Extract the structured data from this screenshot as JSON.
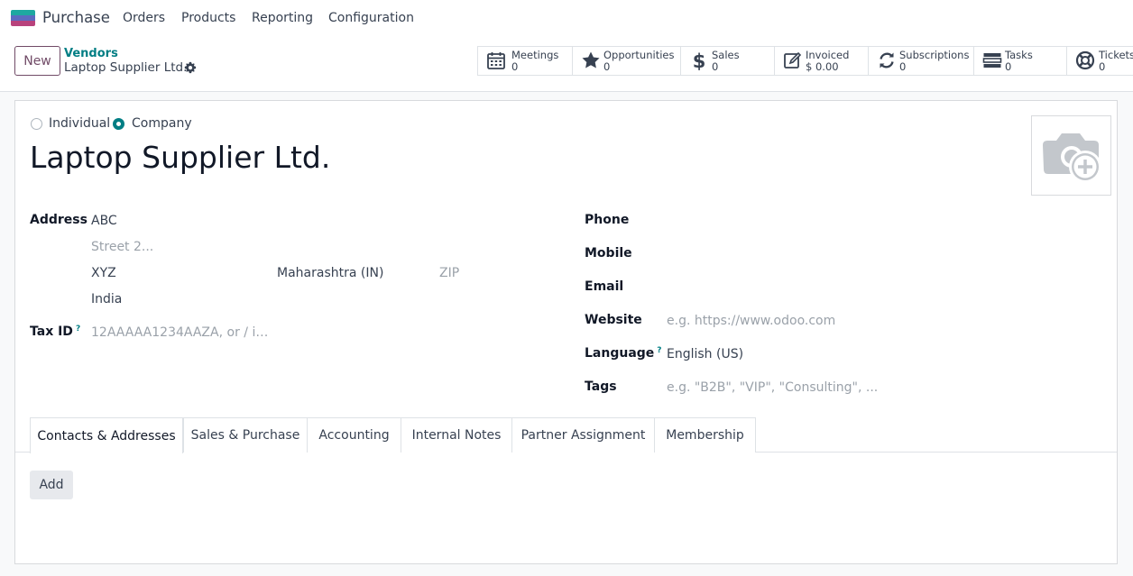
{
  "navbar": {
    "app_name": "Purchase",
    "menu": [
      "Orders",
      "Products",
      "Reporting",
      "Configuration"
    ]
  },
  "breadcrumb": {
    "parent": "Vendors",
    "current": "Laptop Supplier Ltd."
  },
  "new_button": "New",
  "smart_buttons": [
    {
      "icon": "calendar-icon",
      "label": "Meetings",
      "value": "0"
    },
    {
      "icon": "star-icon",
      "label": "Opportunities",
      "value": "0"
    },
    {
      "icon": "dollar-icon",
      "label": "Sales",
      "value": "0"
    },
    {
      "icon": "invoice-icon",
      "label": "Invoiced",
      "value": "$ 0.00"
    },
    {
      "icon": "refresh-icon",
      "label": "Subscriptions",
      "value": "0"
    },
    {
      "icon": "tasks-icon",
      "label": "Tasks",
      "value": "0"
    },
    {
      "icon": "lifebuoy-icon",
      "label": "Tickets",
      "value": "0"
    }
  ],
  "form": {
    "company_type": {
      "individual": "Individual",
      "company": "Company",
      "selected": "Company"
    },
    "name": "Laptop Supplier Ltd.",
    "address_label": "Address",
    "street": "ABC",
    "street2_placeholder": "Street 2...",
    "city": "XYZ",
    "state": "Maharashtra (IN)",
    "zip_placeholder": "ZIP",
    "country": "India",
    "tax_id_label": "Tax ID",
    "tax_id_help": "?",
    "tax_id_placeholder": "12AAAAA1234AAZA, or / i…",
    "phone_label": "Phone",
    "mobile_label": "Mobile",
    "email_label": "Email",
    "website_label": "Website",
    "website_placeholder": "e.g. https://www.odoo.com",
    "language_label": "Language",
    "language_help": "?",
    "language": "English (US)",
    "tags_label": "Tags",
    "tags_placeholder": "e.g. \"B2B\", \"VIP\", \"Consulting\", ..."
  },
  "tabs": [
    "Contacts & Addresses",
    "Sales & Purchase",
    "Accounting",
    "Internal Notes",
    "Partner Assignment",
    "Membership"
  ],
  "active_tab": "Contacts & Addresses",
  "add_button": "Add",
  "colors": {
    "brand": "#714b67",
    "accent": "#017e84"
  }
}
